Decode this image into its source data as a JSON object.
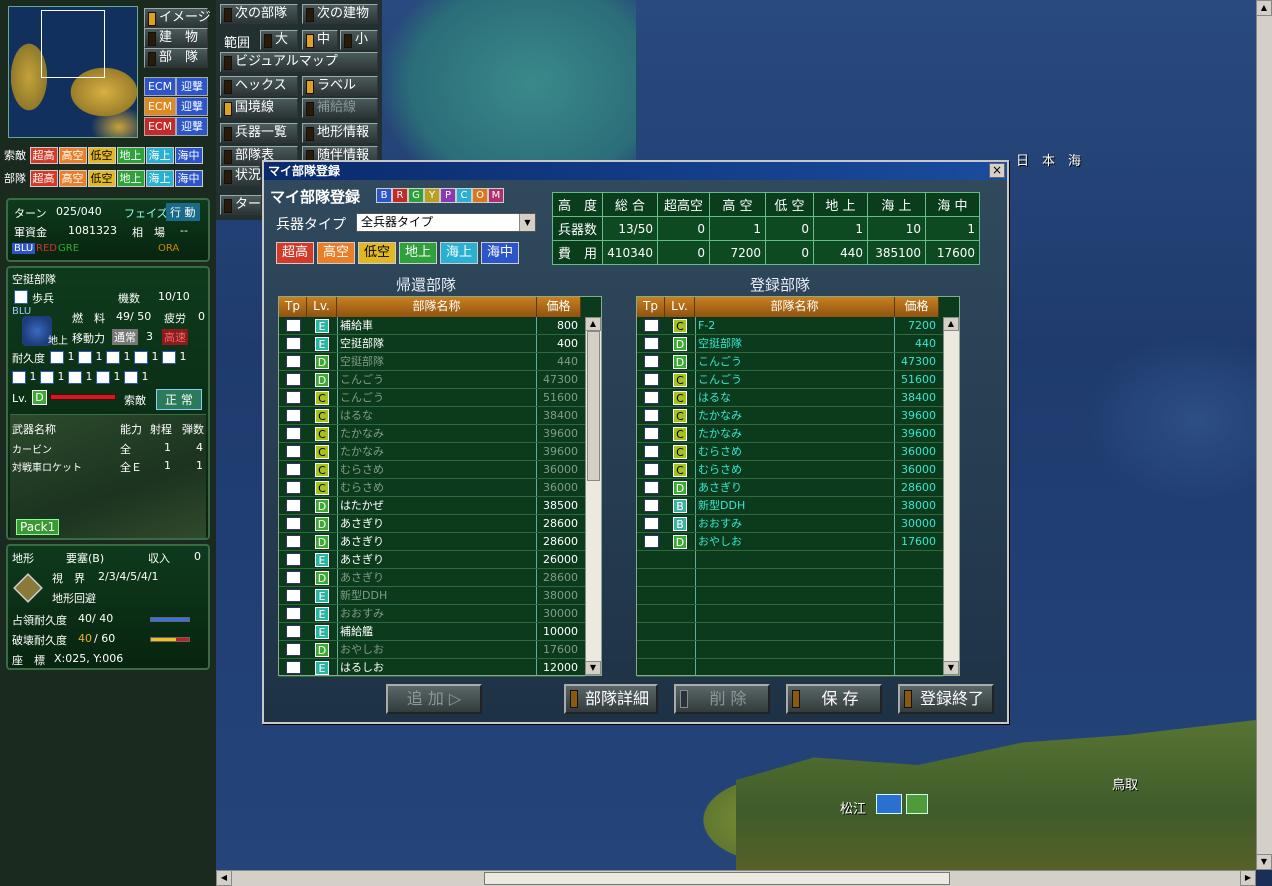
{
  "map": {
    "labels": [
      "日　本　海",
      "松江",
      "鳥取"
    ]
  },
  "left": {
    "view_buttons": [
      {
        "label": "イメージ",
        "on": true
      },
      {
        "label": "建　物",
        "on": false
      },
      {
        "label": "部　隊",
        "on": false
      }
    ],
    "ecm_rows": [
      {
        "ecm": "ECM",
        "mode": "迎撃",
        "color": "#2b55c8"
      },
      {
        "ecm": "ECM",
        "mode": "迎撃",
        "color": "#e0871f"
      },
      {
        "ecm": "ECM",
        "mode": "迎撃",
        "color": "#c42a2a"
      }
    ],
    "search_row": {
      "label": "索敵",
      "tags": [
        "超高",
        "高空",
        "低空",
        "地上",
        "海上",
        "海中"
      ]
    },
    "unit_row": {
      "label": "部隊",
      "tags": [
        "超高",
        "高空",
        "低空",
        "地上",
        "海上",
        "海中"
      ]
    },
    "turn": {
      "turn_label": "ターン",
      "turn": "025/040",
      "phase_label": "フェイズ",
      "phase": "行 動",
      "funds_label": "軍資金",
      "funds": "1081323",
      "market_label": "相　場",
      "market": "--",
      "sides": [
        "BLU",
        "RED",
        "GRE",
        "ORA"
      ]
    },
    "unit": {
      "name": "空挺部隊",
      "type": "歩兵",
      "count_label": "機数",
      "count": "10/10",
      "fuel_label": "燃　料",
      "fuel": "49/ 50",
      "fatigue_label": "疲労",
      "fatigue": "0",
      "side": "BLU",
      "domain": "地上",
      "move_label": "移動力",
      "move_mode": "通常",
      "move": "3",
      "move_fast": "高速",
      "dur_label": "耐久度",
      "lv_label": "Lv.",
      "lv": "D",
      "search_label": "索敵",
      "search": "正 常",
      "durs": [
        "1",
        "1",
        "1",
        "1",
        "1",
        "1",
        "1",
        "1",
        "1",
        "1"
      ]
    },
    "weapons": {
      "headers": [
        "武器名称",
        "能力",
        "射程",
        "弾数"
      ],
      "rows": [
        [
          "カービン",
          "全",
          "1",
          "4"
        ],
        [
          "対戦車ロケット",
          "全Ｅ",
          "1",
          "1"
        ]
      ],
      "pack": "Pack1"
    },
    "terrain": {
      "label": "地形",
      "name": "要塞(B)",
      "income_label": "収入",
      "income": "0",
      "view_label": "視　界",
      "view": "2/3/4/5/4/1",
      "evade": "地形回避",
      "occ_label": "占領耐久度",
      "occ": "40/ 40",
      "occ_ratio": 1.0,
      "dest_label": "破壊耐久度",
      "dest_a": "40",
      "dest_b": "/ 60",
      "dest_ratio": 0.67,
      "coord_label": "座　標",
      "coord": "X:025, Y:006"
    }
  },
  "toolbar": {
    "next_unit": "次の部隊",
    "next_bld": "次の建物",
    "range": "範囲",
    "large": "大",
    "mid": "中",
    "small": "小",
    "visual": "ビジュアルマップ",
    "hex": "ヘックス",
    "label": "ラベル",
    "border": "国境線",
    "supply": "補給線",
    "weapons": "兵器一覧",
    "terrain_info": "地形情報",
    "unit_table": "部隊表",
    "attach": "随伴情報",
    "status": "状況",
    "turn": "ター"
  },
  "dialog": {
    "title": "マイ部隊登録",
    "heading": "マイ部隊登録",
    "colors": [
      "B",
      "R",
      "G",
      "Y",
      "P",
      "C",
      "O",
      "M"
    ],
    "type_label": "兵器タイプ",
    "type_value": "全兵器タイプ",
    "filters": [
      "超高",
      "高空",
      "低空",
      "地上",
      "海上",
      "海中"
    ],
    "stats": {
      "headers": [
        "高　度",
        "総 合",
        "超高空",
        "高 空",
        "低 空",
        "地 上",
        "海 上",
        "海 中"
      ],
      "rows": [
        [
          "兵器数",
          "13/50",
          "0",
          "1",
          "0",
          "1",
          "10",
          "1"
        ],
        [
          "費　用",
          "410340",
          "0",
          "7200",
          "0",
          "440",
          "385100",
          "17600"
        ]
      ]
    },
    "return_title": "帰還部隊",
    "reg_title": "登録部隊",
    "col": {
      "tp": "Tp",
      "lv": "Lv.",
      "name": "部隊名称",
      "price": "価格"
    },
    "return_rows": [
      {
        "lv": "E",
        "name": "補給車",
        "price": "800",
        "dim": false
      },
      {
        "lv": "E",
        "name": "空挺部隊",
        "price": "400",
        "dim": false
      },
      {
        "lv": "D",
        "name": "空挺部隊",
        "price": "440",
        "dim": true
      },
      {
        "lv": "D",
        "name": "こんごう",
        "price": "47300",
        "dim": true
      },
      {
        "lv": "C",
        "name": "こんごう",
        "price": "51600",
        "dim": true
      },
      {
        "lv": "C",
        "name": "はるな",
        "price": "38400",
        "dim": true
      },
      {
        "lv": "C",
        "name": "たかなみ",
        "price": "39600",
        "dim": true
      },
      {
        "lv": "C",
        "name": "たかなみ",
        "price": "39600",
        "dim": true
      },
      {
        "lv": "C",
        "name": "むらさめ",
        "price": "36000",
        "dim": true
      },
      {
        "lv": "C",
        "name": "むらさめ",
        "price": "36000",
        "dim": true
      },
      {
        "lv": "D",
        "name": "はたかぜ",
        "price": "38500",
        "dim": false
      },
      {
        "lv": "D",
        "name": "あさぎり",
        "price": "28600",
        "dim": false
      },
      {
        "lv": "D",
        "name": "あさぎり",
        "price": "28600",
        "dim": false
      },
      {
        "lv": "E",
        "name": "あさぎり",
        "price": "26000",
        "dim": false
      },
      {
        "lv": "D",
        "name": "あさぎり",
        "price": "28600",
        "dim": true
      },
      {
        "lv": "E",
        "name": "新型DDH",
        "price": "38000",
        "dim": true
      },
      {
        "lv": "E",
        "name": "おおすみ",
        "price": "30000",
        "dim": true
      },
      {
        "lv": "E",
        "name": "補給艦",
        "price": "10000",
        "dim": false
      },
      {
        "lv": "D",
        "name": "おやしお",
        "price": "17600",
        "dim": true
      },
      {
        "lv": "E",
        "name": "はるしお",
        "price": "12000",
        "dim": false
      }
    ],
    "reg_rows": [
      {
        "lv": "C",
        "name": "F-2",
        "price": "7200"
      },
      {
        "lv": "D",
        "name": "空挺部隊",
        "price": "440"
      },
      {
        "lv": "D",
        "name": "こんごう",
        "price": "47300"
      },
      {
        "lv": "C",
        "name": "こんごう",
        "price": "51600"
      },
      {
        "lv": "C",
        "name": "はるな",
        "price": "38400"
      },
      {
        "lv": "C",
        "name": "たかなみ",
        "price": "39600"
      },
      {
        "lv": "C",
        "name": "たかなみ",
        "price": "39600"
      },
      {
        "lv": "C",
        "name": "むらさめ",
        "price": "36000"
      },
      {
        "lv": "C",
        "name": "むらさめ",
        "price": "36000"
      },
      {
        "lv": "D",
        "name": "あさぎり",
        "price": "28600"
      },
      {
        "lv": "B",
        "name": "新型DDH",
        "price": "38000"
      },
      {
        "lv": "B",
        "name": "おおすみ",
        "price": "30000"
      },
      {
        "lv": "D",
        "name": "おやしお",
        "price": "17600"
      }
    ],
    "buttons": {
      "add": "追 加",
      "detail": "部隊詳細",
      "remove": "削 除",
      "save": "保 存",
      "finish": "登録終了"
    }
  }
}
